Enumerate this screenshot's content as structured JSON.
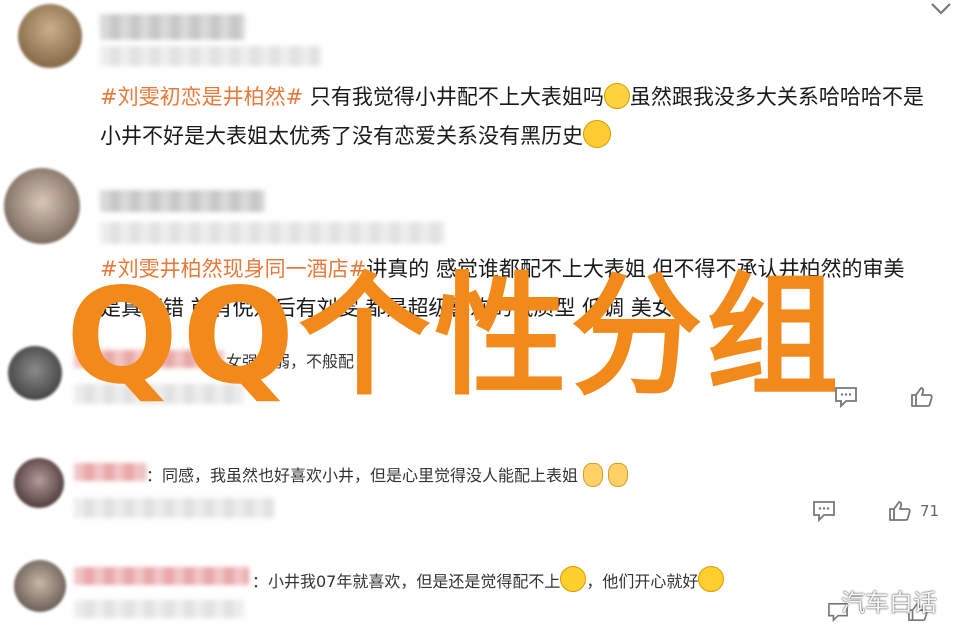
{
  "posts": [
    {
      "hashtag": "#刘雯初恋是井柏然#",
      "line1": "只有我觉得小井配不上大表姐吗",
      "line1b": "虽然跟我没多大关系哈哈哈不是",
      "line2": "小井不好是大表姐太优秀了没有恋爱关系没有黑历史"
    },
    {
      "hashtag": "#刘雯井柏然现身同一酒店#",
      "line1": "讲真的 感觉谁都配不上大表姐 但不得不承认井柏然的审美",
      "line2": "是真不错 前有倪妮后有刘雯 都是超级喜欢的气质型 低调 美女"
    }
  ],
  "replies": [
    {
      "text": "女强男弱，不般配"
    },
    {
      "text": "：同感，我虽然也好喜欢小井，但是心里觉得没人能配上表姐",
      "likes": "71"
    },
    {
      "text": "：小井我07年就喜欢，但是还是觉得配不上",
      "text2": "，他们开心就好"
    }
  ],
  "overlay": {
    "title": "QQ个性分组"
  },
  "watermark": "汽车白话",
  "icons": [
    "chevron-down-icon",
    "comment-icon",
    "like-icon",
    "smile-emoji",
    "thinking-emoji",
    "laughing-emoji",
    "small-figure-emoji"
  ],
  "colors": {
    "hashtag": "#e8793a",
    "overlay": "#f28a1b"
  }
}
